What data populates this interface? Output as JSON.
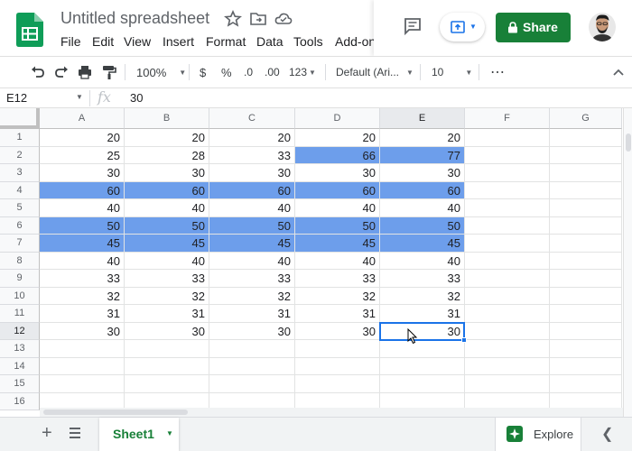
{
  "header": {
    "doc_title": "Untitled spreadsheet",
    "menu": [
      "File",
      "Edit",
      "View",
      "Insert",
      "Format",
      "Data",
      "Tools",
      "Add-ons"
    ],
    "share_label": "Share"
  },
  "toolbar": {
    "zoom": "100%",
    "currency": "$",
    "percent": "%",
    "decrease_decimal": ".0",
    "increase_decimal": ".00",
    "more_formats": "123",
    "font": "Default (Ari...",
    "font_size": "10",
    "more": "⋯"
  },
  "formula_bar": {
    "name_box": "E12",
    "fx": "fx",
    "value": "30"
  },
  "grid": {
    "columns": [
      "A",
      "B",
      "C",
      "D",
      "E",
      "F",
      "G"
    ],
    "selected_column": "E",
    "selected_row": "12",
    "rows": [
      {
        "n": "1",
        "cells": [
          "20",
          "20",
          "20",
          "20",
          "20"
        ],
        "hl": [
          false,
          false,
          false,
          false,
          false
        ]
      },
      {
        "n": "2",
        "cells": [
          "25",
          "28",
          "33",
          "66",
          "77"
        ],
        "hl": [
          false,
          false,
          false,
          true,
          true
        ]
      },
      {
        "n": "3",
        "cells": [
          "30",
          "30",
          "30",
          "30",
          "30"
        ],
        "hl": [
          false,
          false,
          false,
          false,
          false
        ]
      },
      {
        "n": "4",
        "cells": [
          "60",
          "60",
          "60",
          "60",
          "60"
        ],
        "hl": [
          true,
          true,
          true,
          true,
          true
        ]
      },
      {
        "n": "5",
        "cells": [
          "40",
          "40",
          "40",
          "40",
          "40"
        ],
        "hl": [
          false,
          false,
          false,
          false,
          false
        ]
      },
      {
        "n": "6",
        "cells": [
          "50",
          "50",
          "50",
          "50",
          "50"
        ],
        "hl": [
          true,
          true,
          true,
          true,
          true
        ]
      },
      {
        "n": "7",
        "cells": [
          "45",
          "45",
          "45",
          "45",
          "45"
        ],
        "hl": [
          true,
          true,
          true,
          true,
          true
        ]
      },
      {
        "n": "8",
        "cells": [
          "40",
          "40",
          "40",
          "40",
          "40"
        ],
        "hl": [
          false,
          false,
          false,
          false,
          false
        ]
      },
      {
        "n": "9",
        "cells": [
          "33",
          "33",
          "33",
          "33",
          "33"
        ],
        "hl": [
          false,
          false,
          false,
          false,
          false
        ]
      },
      {
        "n": "10",
        "cells": [
          "32",
          "32",
          "32",
          "32",
          "32"
        ],
        "hl": [
          false,
          false,
          false,
          false,
          false
        ]
      },
      {
        "n": "11",
        "cells": [
          "31",
          "31",
          "31",
          "31",
          "31"
        ],
        "hl": [
          false,
          false,
          false,
          false,
          false
        ]
      },
      {
        "n": "12",
        "cells": [
          "30",
          "30",
          "30",
          "30",
          "30"
        ],
        "hl": [
          false,
          false,
          false,
          false,
          false
        ]
      },
      {
        "n": "13",
        "cells": [
          "",
          "",
          "",
          "",
          ""
        ],
        "hl": [
          false,
          false,
          false,
          false,
          false
        ]
      },
      {
        "n": "14",
        "cells": [
          "",
          "",
          "",
          "",
          ""
        ],
        "hl": [
          false,
          false,
          false,
          false,
          false
        ]
      },
      {
        "n": "15",
        "cells": [
          "",
          "",
          "",
          "",
          ""
        ],
        "hl": [
          false,
          false,
          false,
          false,
          false
        ]
      },
      {
        "n": "16",
        "cells": [
          "",
          "",
          "",
          "",
          ""
        ],
        "hl": [
          false,
          false,
          false,
          false,
          false
        ]
      }
    ]
  },
  "bottom": {
    "sheet_tab": "Sheet1",
    "explore_label": "Explore"
  },
  "colors": {
    "highlight": "#6d9eeb",
    "brand_green": "#188038",
    "selection_blue": "#1a73e8"
  },
  "icons": [
    "sheets-logo-icon",
    "star-icon",
    "move-folder-icon",
    "cloud-saved-icon",
    "comment-icon",
    "present-icon",
    "lock-icon",
    "undo-icon",
    "redo-icon",
    "print-icon",
    "paint-format-icon",
    "add-icon",
    "all-sheets-icon",
    "explore-icon",
    "chevron-left-icon"
  ]
}
